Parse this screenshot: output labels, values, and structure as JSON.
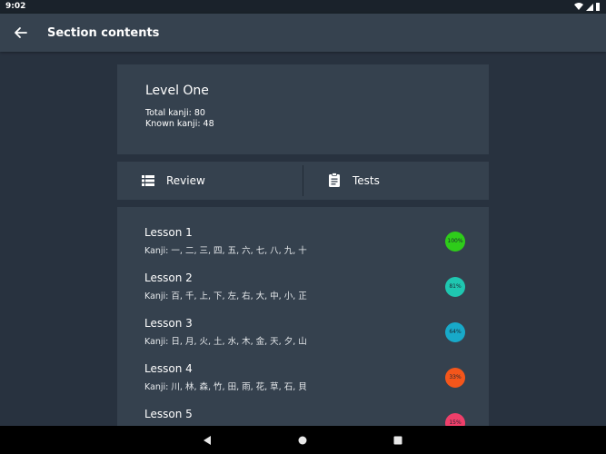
{
  "status_bar": {
    "time": "9:02"
  },
  "toolbar": {
    "title": "Section contents"
  },
  "level": {
    "title": "Level One",
    "total_kanji": "Total kanji:  80",
    "known_kanji": "Known kanji: 48"
  },
  "actions": {
    "review_label": "Review",
    "tests_label": "Tests"
  },
  "lessons": [
    {
      "title": "Lesson 1",
      "kanji": "Kanji:  一, 二, 三, 四, 五, 六, 七, 八, 九, 十",
      "progress": "100%",
      "color": "#2ecc1a"
    },
    {
      "title": "Lesson 2",
      "kanji": "Kanji:  百, 千, 上, 下, 左, 右, 大, 中, 小, 正",
      "progress": "81%",
      "color": "#1fc6b0"
    },
    {
      "title": "Lesson 3",
      "kanji": "Kanji:  日, 月, 火, 土, 水, 木, 金, 天, 夕, 山",
      "progress": "64%",
      "color": "#18a9c9"
    },
    {
      "title": "Lesson 4",
      "kanji": "Kanji:  川, 林, 森, 竹, 田, 雨, 花, 草, 石, 貝",
      "progress": "33%",
      "color": "#f4561b"
    },
    {
      "title": "Lesson 5",
      "kanji": "",
      "progress": "15%",
      "color": "#ef3f6a"
    }
  ],
  "colors": {
    "background": "#28323f",
    "card": "#35414e",
    "toolbar": "#36424f"
  }
}
